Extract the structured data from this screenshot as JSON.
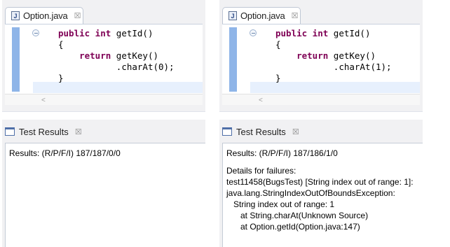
{
  "panels": [
    {
      "editor": {
        "tab_label": "Option.java",
        "file_icon_letter": "J",
        "close_glyph": "☒",
        "code": {
          "line1_kw": "public int",
          "line1_rest": " getId()",
          "line2": "{",
          "line3_kw": "return",
          "line3_rest": " getKey()",
          "line4": ".charAt(0);",
          "line5": "}"
        }
      },
      "results": {
        "tab_label": "Test Results",
        "close_glyph": "☒",
        "summary": "Results: (R/P/F/I) 187/187/0/0"
      }
    },
    {
      "editor": {
        "tab_label": "Option.java",
        "file_icon_letter": "J",
        "close_glyph": "☒",
        "code": {
          "line1_kw": "public int",
          "line1_rest": " getId()",
          "line2": "{",
          "line3_kw": "return",
          "line3_rest": " getKey()",
          "line4": ".charAt(1);",
          "line5": "}"
        }
      },
      "results": {
        "tab_label": "Test Results",
        "close_glyph": "☒",
        "summary": "Results: (R/P/F/I) 187/186/1/0",
        "failures_heading": "Details for failures:",
        "failure_lines": [
          "test11458(BugsTest) [String index out of range: 1]:",
          "java.lang.StringIndexOutOfBoundsException:",
          "   String index out of range: 1",
          "      at String.charAt(Unknown Source)",
          "      at Option.getId(Option.java:147)"
        ]
      }
    }
  ],
  "icons": {
    "file": "java-file-icon",
    "fold": "fold-collapse-icon",
    "close": "close-icon",
    "window": "test-results-window-icon",
    "scroll": "scroll-left-arrow-icon"
  },
  "scroll_left_glyph": "<"
}
